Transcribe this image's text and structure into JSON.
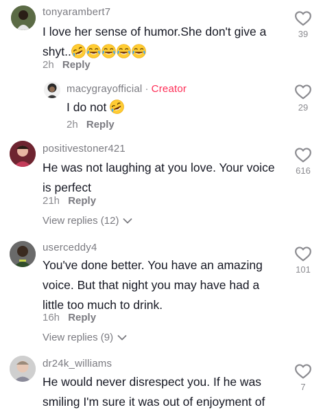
{
  "comments": [
    {
      "username": "tonyarambert7",
      "text_line1": "I love her sense of humor.She don't give a",
      "text_line2": "shyt..",
      "time": "2h",
      "reply_label": "Reply",
      "likes": "39",
      "emojis": [
        "rofl",
        "joy",
        "joy",
        "joy",
        "joy"
      ]
    },
    {
      "username": "macygrayofficial",
      "separator": "·",
      "badge": "Creator",
      "text": "I do not",
      "time": "2h",
      "reply_label": "Reply",
      "likes": "29",
      "emojis": [
        "rofl"
      ]
    },
    {
      "username": "positivestoner421",
      "text_line1": "He was not laughing at you love. Your voice",
      "text_line2": "is perfect",
      "time": "21h",
      "reply_label": "Reply",
      "view_replies": "View replies (12)",
      "likes": "616"
    },
    {
      "username": "userceddy4",
      "text_line1": "You've done better. You have an amazing",
      "text_line2": "voice. But that night you may have had a",
      "text_line3": "little too much to drink.",
      "time": "16h",
      "reply_label": "Reply",
      "view_replies": "View replies (9)",
      "likes": "101"
    },
    {
      "username": "dr24k_williams",
      "text_line1": "He would never disrespect you. If he was",
      "text_line2": "smiling I'm sure it was out of enjoyment of",
      "likes": "7"
    }
  ],
  "icons": {
    "like": "heart-outline-icon",
    "expand": "chevron-down-icon"
  },
  "colors": {
    "creator_badge": "#fe2c55",
    "meta_text": "#8a8a8f",
    "body_text": "#161823"
  }
}
